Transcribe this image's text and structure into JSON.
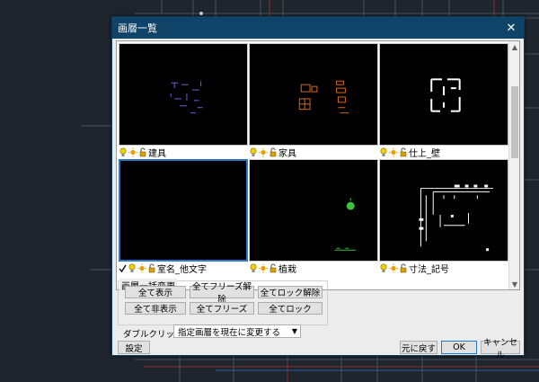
{
  "dialog": {
    "title": "画層一覧",
    "close_glyph": "✕"
  },
  "layers": [
    {
      "name": "建具",
      "selected": false,
      "checked": false
    },
    {
      "name": "家具",
      "selected": false,
      "checked": false
    },
    {
      "name": "仕上_壁",
      "selected": false,
      "checked": false
    },
    {
      "name": "室名_他文字",
      "selected": true,
      "checked": true
    },
    {
      "name": "植栽",
      "selected": false,
      "checked": false
    },
    {
      "name": "寸法_記号",
      "selected": false,
      "checked": false
    }
  ],
  "batch": {
    "title": "画層一括変更",
    "show_all": "全て表示",
    "unfreeze_all": "全てフリーズ解除",
    "unlock_all": "全てロック解除",
    "hide_all": "全て非表示",
    "freeze_all": "全てフリーズ",
    "lock_all": "全てロック"
  },
  "double_click": {
    "label": "ダブルクリック:",
    "value": "指定画層を現在に変更する"
  },
  "footer": {
    "settings": "設定",
    "revert": "元に戻す",
    "ok": "OK",
    "cancel": "キャンセル"
  },
  "icons": {
    "bulb": "bulb-icon",
    "sun": "sun-icon",
    "lock": "lock-icon",
    "check": "check-icon"
  },
  "colors": {
    "titlebar": "#0f4468",
    "thumb_bg": "#000000",
    "selection": "#2a78c8",
    "bulb": "#f5d000",
    "sun": "#e8a000"
  }
}
